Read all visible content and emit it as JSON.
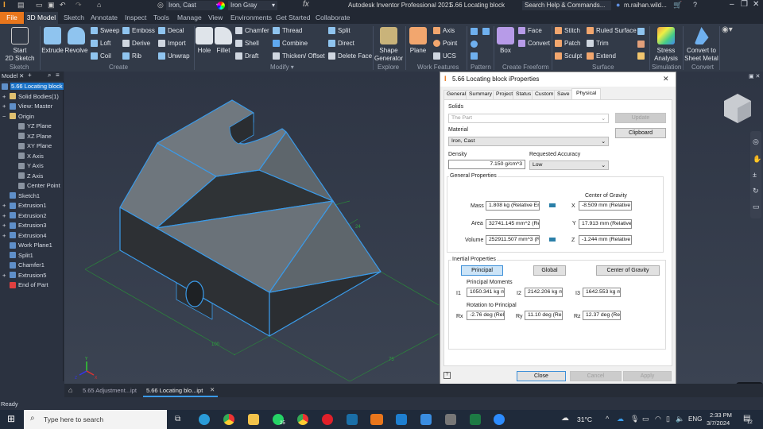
{
  "app": {
    "title": "Autodesk Inventor Professional 2021",
    "document": "5.66 Locating block",
    "search_placeholder": "Search Help & Commands...",
    "user": "m.raihan.wild...",
    "material": "Iron, Cast",
    "appearance": "Iron Gray",
    "fx": "fx"
  },
  "ribbon_tabs": [
    "File",
    "3D Model",
    "Sketch",
    "Annotate",
    "Inspect",
    "Tools",
    "Manage",
    "View",
    "Environments",
    "Get Started",
    "Collaborate"
  ],
  "ribbon": {
    "sketch": {
      "label": "Sketch",
      "start": "Start",
      "start2": "2D Sketch"
    },
    "create": {
      "label": "Create",
      "extrude": "Extrude",
      "revolve": "Revolve",
      "sweep": "Sweep",
      "loft": "Loft",
      "coil": "Coil",
      "emboss": "Emboss",
      "derive": "Derive",
      "rib": "Rib",
      "decal": "Decal",
      "import": "Import",
      "unwrap": "Unwrap"
    },
    "modify": {
      "label": "Modify ▾",
      "hole": "Hole",
      "fillet": "Fillet",
      "chamfer": "Chamfer",
      "shell": "Shell",
      "draft": "Draft",
      "thread": "Thread",
      "combine": "Combine",
      "thicken": "Thicken/ Offset",
      "split": "Split",
      "direct": "Direct",
      "delete_face": "Delete Face"
    },
    "explore": {
      "label": "Explore",
      "shape1": "Shape",
      "shape2": "Generator"
    },
    "work": {
      "label": "Work Features",
      "plane": "Plane",
      "axis": "Axis",
      "point": "Point",
      "ucs": "UCS"
    },
    "pattern": {
      "label": "Pattern"
    },
    "freeform": {
      "label": "Create Freeform",
      "box": "Box",
      "face": "Face",
      "convert": "Convert"
    },
    "surface": {
      "label": "Surface",
      "stitch": "Stitch",
      "patch": "Patch",
      "sculpt": "Sculpt",
      "ruled": "Ruled Surface",
      "trim": "Trim",
      "extend": "Extend"
    },
    "simulation": {
      "label": "Simulation",
      "stress1": "Stress",
      "stress2": "Analysis"
    },
    "convert": {
      "label": "Convert",
      "c1": "Convert to",
      "c2": "Sheet Metal"
    }
  },
  "browser": {
    "tab": "Model",
    "items": [
      "5.66 Locating block",
      "Solid Bodies(1)",
      "View: Master",
      "Origin",
      "YZ Plane",
      "XZ Plane",
      "XY Plane",
      "X Axis",
      "Y Axis",
      "Z Axis",
      "Center Point",
      "Sketch1",
      "Extrusion1",
      "Extrusion2",
      "Extrusion3",
      "Extrusion4",
      "Work Plane1",
      "Split1",
      "Chamfer1",
      "Extrusion5",
      "End of Part"
    ]
  },
  "viewport": {
    "dims": [
      "100",
      "75",
      "24"
    ],
    "axes": [
      "Y",
      "Z",
      "X"
    ]
  },
  "dialog": {
    "title": "5.66 Locating block iProperties",
    "tabs": [
      "General",
      "Summary",
      "Project",
      "Status",
      "Custom",
      "Save",
      "Physical"
    ],
    "solids_label": "Solids",
    "solids_value": "The Part",
    "material_label": "Material",
    "material_value": "Iron, Cast",
    "density_label": "Density",
    "density_value": "7.150 g/cm^3",
    "accuracy_label": "Requested Accuracy",
    "accuracy_value": "Low",
    "update": "Update",
    "clipboard": "Clipboard",
    "general_label": "General Properties",
    "cog_label": "Center of Gravity",
    "mass_label": "Mass",
    "mass": "1.808 kg (Relative Err",
    "area_label": "Area",
    "area": "32741.145 mm^2 (Re",
    "volume_label": "Volume",
    "volume": "252911.507 mm^3 (R",
    "x_label": "X",
    "x": "-8.509 mm (Relative E",
    "y_label": "Y",
    "y": "17.913 mm (Relative E",
    "z_label": "Z",
    "z": "-1.244 mm (Relative E",
    "inertial_label": "Inertial Properties",
    "principal": "Principal",
    "global": "Global",
    "cog_button": "Center of Gravity",
    "moments_label": "Principal Moments",
    "i1_label": "I1",
    "i1": "1050.341 kg mi",
    "i2_label": "I2",
    "i2": "2142.206 kg mi",
    "i3_label": "I3",
    "i3": "1642.553 kg mi",
    "rotation_label": "Rotation to Principal",
    "rx_label": "Rx",
    "rx": "-2.76 deg (Rela",
    "ry_label": "Ry",
    "ry": "11.10 deg (Rela",
    "rz_label": "Rz",
    "rz": "12.37 deg (Rela",
    "close": "Close",
    "cancel": "Cancel",
    "apply": "Apply"
  },
  "doc_tabs": [
    "5.65 Adjustment...ipt",
    "5.66 Locating blo...ipt"
  ],
  "status": "Ready",
  "taskbar": {
    "search_placeholder": "Type here to search",
    "whatsapp_badge": "25",
    "weather": "31°C",
    "lang": "ENG",
    "time": "2:33 PM",
    "date": "3/7/2024",
    "notif": "12"
  }
}
